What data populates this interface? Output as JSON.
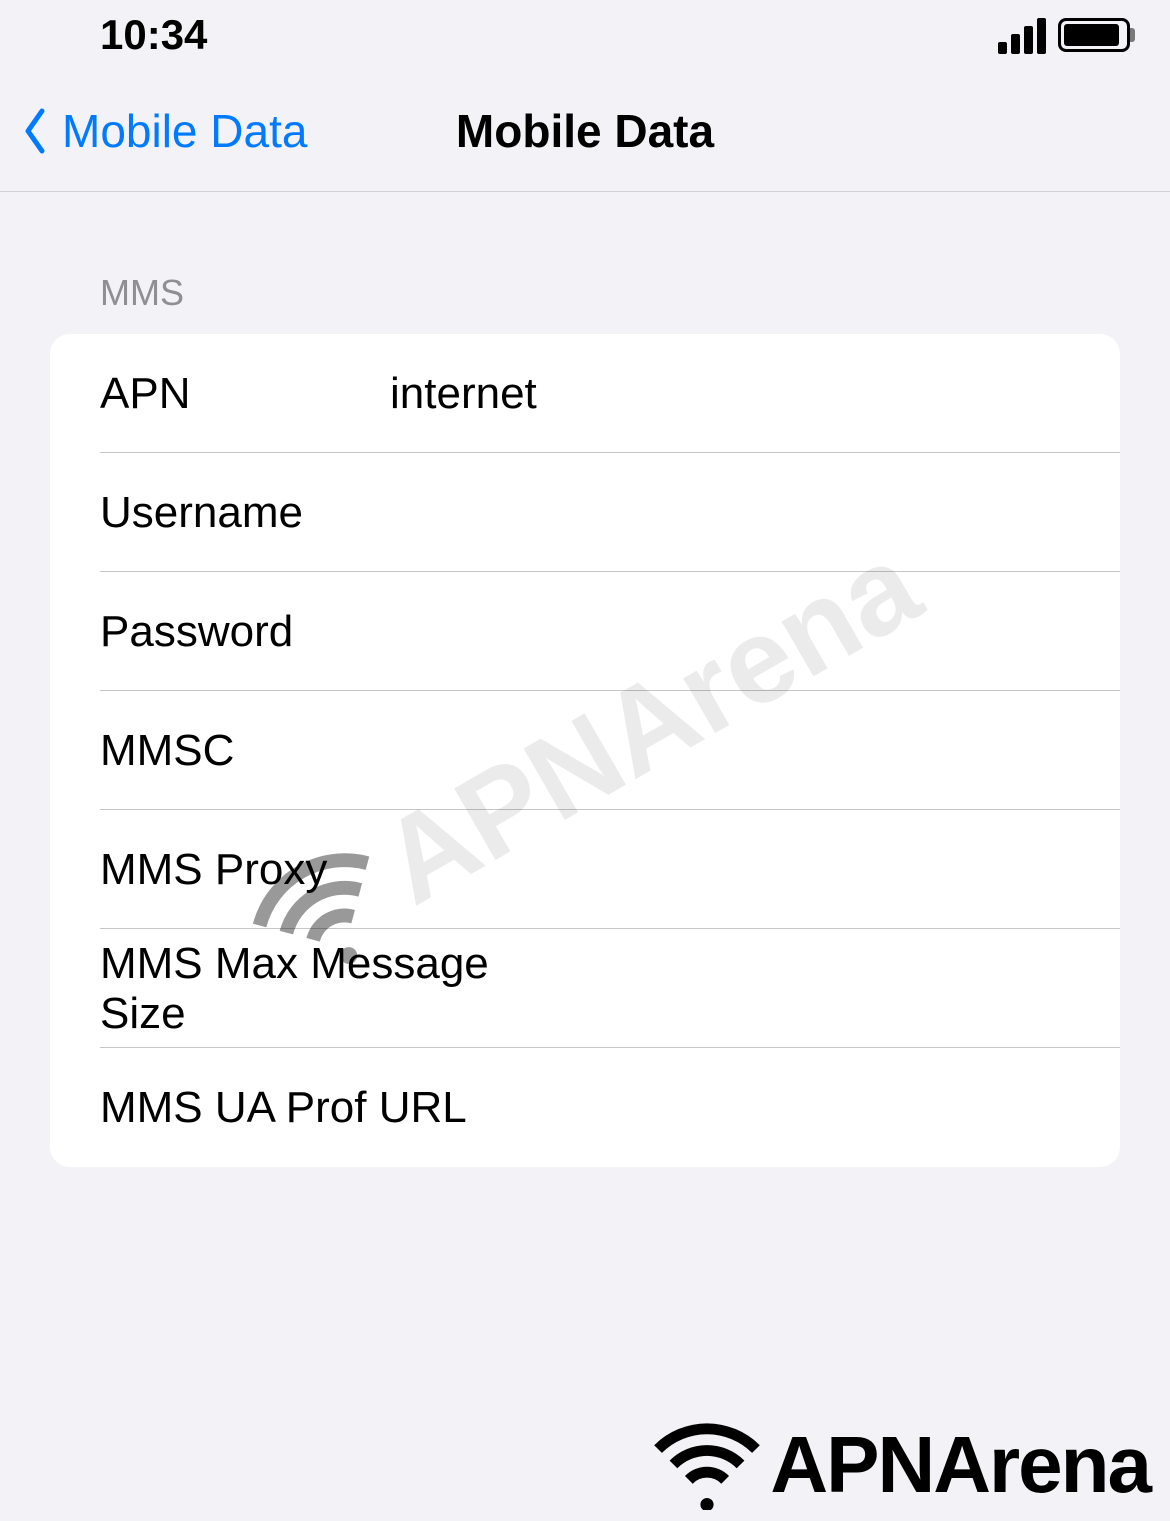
{
  "status": {
    "time": "10:34"
  },
  "nav": {
    "back_label": "Mobile Data",
    "title": "Mobile Data"
  },
  "section": {
    "header": "MMS"
  },
  "fields": {
    "apn": {
      "label": "APN",
      "value": "internet"
    },
    "username": {
      "label": "Username",
      "value": ""
    },
    "password": {
      "label": "Password",
      "value": ""
    },
    "mmsc": {
      "label": "MMSC",
      "value": ""
    },
    "mms_proxy": {
      "label": "MMS Proxy",
      "value": ""
    },
    "mms_max_size": {
      "label": "MMS Max Message Size",
      "value": ""
    },
    "mms_ua_prof": {
      "label": "MMS UA Prof URL",
      "value": ""
    }
  },
  "watermark": "APNArena",
  "footer_logo": "APNArena"
}
